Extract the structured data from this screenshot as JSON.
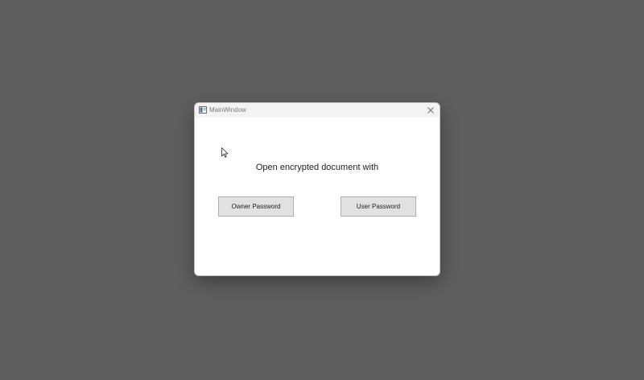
{
  "window": {
    "title": "MainWindow",
    "icon": "app-window-icon",
    "close_icon": "close-icon"
  },
  "content": {
    "prompt": "Open encrypted document with",
    "owner_button_label": "Owner Password",
    "user_button_label": "User Password"
  },
  "colors": {
    "desktop": "#5f5f61",
    "window_bg": "#ffffff",
    "titlebar_bg": "#f3f3f3",
    "button_bg": "#e1e1e1",
    "button_border": "#adadad"
  }
}
